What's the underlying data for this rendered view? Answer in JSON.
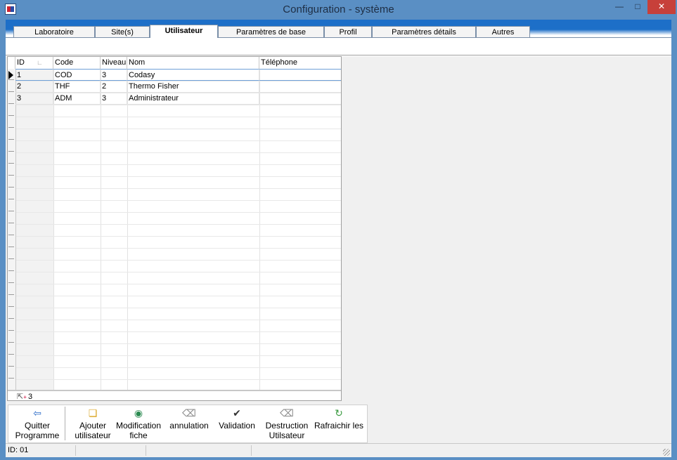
{
  "window": {
    "title": "Configuration - système"
  },
  "tabs": [
    {
      "label": "Laboratoire"
    },
    {
      "label": "Site(s)"
    },
    {
      "label": "Utilisateur"
    },
    {
      "label": "Paramètres de base"
    },
    {
      "label": "Profil"
    },
    {
      "label": "Paramètres détails"
    },
    {
      "label": "Autres"
    }
  ],
  "grid": {
    "columns": [
      "ID",
      "Code",
      "Niveau",
      "Nom",
      "Téléphone"
    ],
    "rows": [
      {
        "id": "1",
        "code": "COD",
        "niveau": "3",
        "nom": "Codasy",
        "telephone": ""
      },
      {
        "id": "2",
        "code": "THF",
        "niveau": "2",
        "nom": "Thermo Fisher",
        "telephone": ""
      },
      {
        "id": "3",
        "code": "ADM",
        "niveau": "3",
        "nom": "Administrateur",
        "telephone": ""
      }
    ],
    "footer_count": "3"
  },
  "toolbar": {
    "quit": "Quitter Programme",
    "add": "Ajouter utilisateur",
    "edit": "Modification fiche",
    "cancel": "annulation",
    "validate": "Validation",
    "delete": "Destruction Utilsateur",
    "refresh": "Rafraichir les"
  },
  "status": {
    "id_text": "ID: 01"
  },
  "colors": {
    "title_bar": "#5a8fc4",
    "tab_strip": "#1d6fc8",
    "close": "#c7403a"
  }
}
